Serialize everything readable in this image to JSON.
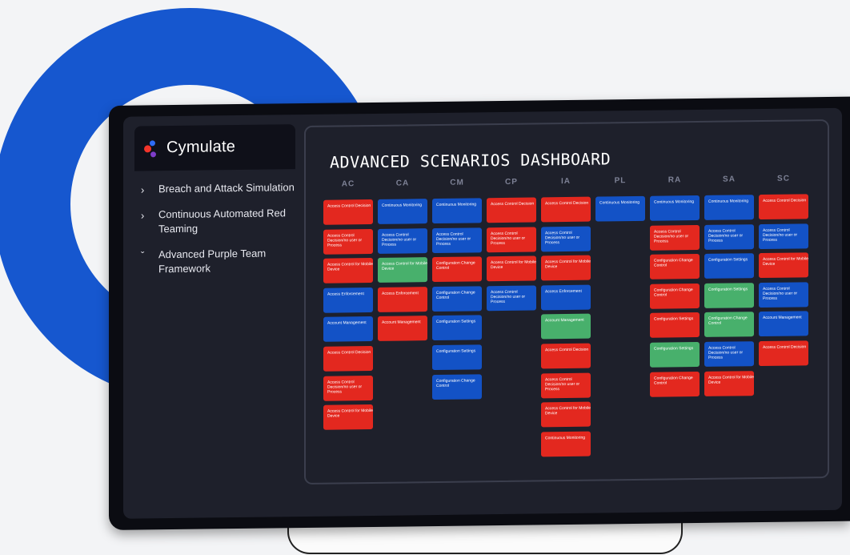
{
  "brand": {
    "name": "Cymulate"
  },
  "nav": {
    "items": [
      {
        "label": "Breach and Attack Simulation",
        "icon": "chevron-right-icon",
        "glyph": "›"
      },
      {
        "label": "Continuous Automated Red Teaming",
        "icon": "chevron-right-icon",
        "glyph": "›"
      },
      {
        "label": "Advanced Purple Team Framework",
        "icon": "chevron-down-icon",
        "glyph": "ˇ"
      }
    ]
  },
  "dashboard": {
    "title": "ADVANCED SCENARIOS DASHBOARD",
    "colors": {
      "red": "#e3281f",
      "blue": "#1352c6",
      "green": "#48b06c"
    },
    "columns": [
      {
        "header": "AC",
        "cards": [
          {
            "label": "Access Control Decision",
            "color": "red"
          },
          {
            "label": "Access Control Decision/no user or Process",
            "color": "red"
          },
          {
            "label": "Access Control for Mobile Device",
            "color": "red"
          },
          {
            "label": "Access Enforcement",
            "color": "blue"
          },
          {
            "label": "Account Management",
            "color": "blue"
          },
          {
            "label": "Access Control Decision",
            "color": "red"
          },
          {
            "label": "Access Control Decision/no user or Process",
            "color": "red"
          },
          {
            "label": "Access Control for Mobile Device",
            "color": "red"
          }
        ]
      },
      {
        "header": "CA",
        "cards": [
          {
            "label": "Continuous Monitoring",
            "color": "blue"
          },
          {
            "label": "Access Control Decision/no user or Process",
            "color": "blue"
          },
          {
            "label": "Access Control for Mobile Device",
            "color": "green"
          },
          {
            "label": "Access Enforcement",
            "color": "red"
          },
          {
            "label": "Account Management",
            "color": "red"
          }
        ]
      },
      {
        "header": "CM",
        "cards": [
          {
            "label": "Continuous Monitoring",
            "color": "blue"
          },
          {
            "label": "Access Control Decision/no user or Process",
            "color": "blue"
          },
          {
            "label": "Configuration Change Control",
            "color": "red"
          },
          {
            "label": "Configuration Change Control",
            "color": "blue"
          },
          {
            "label": "Configuration Settings",
            "color": "blue"
          },
          {
            "label": "Configuration Settings",
            "color": "blue"
          },
          {
            "label": "Configuration Change Control",
            "color": "blue"
          }
        ]
      },
      {
        "header": "CP",
        "cards": [
          {
            "label": "Access Control Decision",
            "color": "red"
          },
          {
            "label": "Access Control Decision/no user or Process",
            "color": "red"
          },
          {
            "label": "Access Control for Mobile Device",
            "color": "red"
          },
          {
            "label": "Access Control Decision/no user or Process",
            "color": "blue"
          }
        ]
      },
      {
        "header": "IA",
        "cards": [
          {
            "label": "Access Control Decision",
            "color": "red"
          },
          {
            "label": "Access Control Decision/no user or Process",
            "color": "blue"
          },
          {
            "label": "Access Control for Mobile Device",
            "color": "red"
          },
          {
            "label": "Access Enforcement",
            "color": "blue"
          },
          {
            "label": "Account Management",
            "color": "green"
          },
          {
            "label": "Access Control Decision",
            "color": "red"
          },
          {
            "label": "Access Control Decision/no user or Process",
            "color": "red"
          },
          {
            "label": "Access Control for Mobile Device",
            "color": "red"
          },
          {
            "label": "Continuous Monitoring",
            "color": "red"
          }
        ]
      },
      {
        "header": "PL",
        "cards": [
          {
            "label": "Continuous Monitoring",
            "color": "blue"
          }
        ]
      },
      {
        "header": "RA",
        "cards": [
          {
            "label": "Continuous Monitoring",
            "color": "blue"
          },
          {
            "label": "Access Control Decision/no user or Process",
            "color": "red"
          },
          {
            "label": "Configuration Change Control",
            "color": "red"
          },
          {
            "label": "Configuration Change Control",
            "color": "red"
          },
          {
            "label": "Configuration Settings",
            "color": "red"
          },
          {
            "label": "Configuration Settings",
            "color": "green"
          },
          {
            "label": "Configuration Change Control",
            "color": "red"
          }
        ]
      },
      {
        "header": "SA",
        "cards": [
          {
            "label": "Continuous Monitoring",
            "color": "blue"
          },
          {
            "label": "Access Control Decision/no user or Process",
            "color": "blue"
          },
          {
            "label": "Configuration Settings",
            "color": "blue"
          },
          {
            "label": "Configuration Settings",
            "color": "green"
          },
          {
            "label": "Configuration Change Control",
            "color": "green"
          },
          {
            "label": "Access Control Decision/no user or Process",
            "color": "blue"
          },
          {
            "label": "Access Control for Mobile Device",
            "color": "red"
          }
        ]
      },
      {
        "header": "SC",
        "cards": [
          {
            "label": "Access Control Decision",
            "color": "red"
          },
          {
            "label": "Access Control Decision/no user or Process",
            "color": "blue"
          },
          {
            "label": "Access Control for Mobile Device",
            "color": "red"
          },
          {
            "label": "Access Control Decision/no user or Process",
            "color": "blue"
          },
          {
            "label": "Account Management",
            "color": "blue"
          },
          {
            "label": "Access Control Decision",
            "color": "red"
          }
        ]
      }
    ]
  }
}
